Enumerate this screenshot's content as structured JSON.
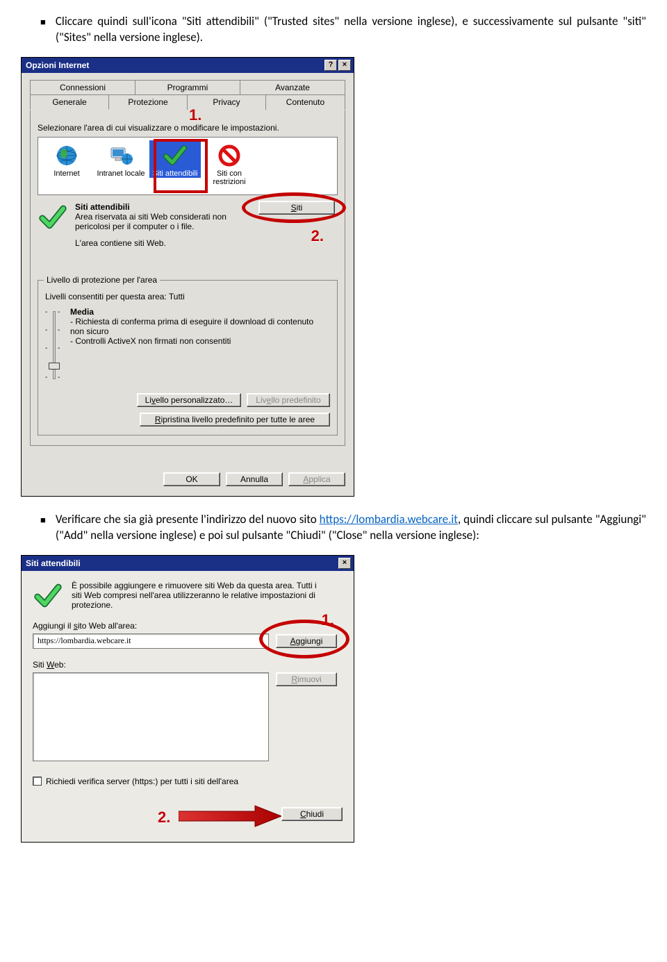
{
  "para1": "Cliccare quindi sull'icona \"Siti attendibili\" (\"Trusted sites\" nella versione inglese), e successivamente sul pulsante \"siti\" (\"Sites\" nella versione inglese).",
  "para2_a": "Verificare che sia già presente l'indirizzo del nuovo sito ",
  "para2_link": "https://lombardia.webcare.it",
  "para2_b": ", quindi cliccare sul pulsante \"Aggiungi\" (\"Add\" nella versione inglese) e poi sul pulsante \"Chiudi\" (\"Close\" nella versione inglese):",
  "dlg1": {
    "title": "Opzioni Internet",
    "help_btn": "?",
    "close_btn": "×",
    "tabs_row2": [
      "Connessioni",
      "Programmi",
      "Avanzate"
    ],
    "tabs_row1": [
      "Generale",
      "Protezione",
      "Privacy",
      "Contenuto"
    ],
    "hint": "Selezionare l'area di cui visualizzare o modificare le impostazioni.",
    "zones": [
      "Internet",
      "Intranet locale",
      "Siti attendibili",
      "Siti con restrizioni"
    ],
    "marker1": "1.",
    "marker2": "2.",
    "zone_desc_title": "Siti attendibili",
    "zone_desc_body": "Area riservata ai siti Web considerati non pericolosi per il computer o i file.",
    "zone_desc_extra": "L'area contiene siti Web.",
    "siti_btn": "Siti",
    "group_legend": "Livello di protezione per l'area",
    "allowed": "Livelli consentiti per questa area: Tutti",
    "level_name": "Media",
    "level_l1": "- Richiesta di conferma prima di eseguire il download di contenuto non sicuro",
    "level_l2": "- Controlli ActiveX non firmati non consentiti",
    "btn_custom": "Livello personalizzato…",
    "btn_default": "Livello predefinito",
    "btn_reset": "Ripristina livello predefinito per tutte le aree",
    "ok": "OK",
    "cancel": "Annulla",
    "apply": "Applica"
  },
  "dlg2": {
    "title": "Siti attendibili",
    "close_btn": "×",
    "intro": "È possibile aggiungere e rimuovere siti Web da questa area. Tutti i siti Web compresi nell'area utilizzeranno le relative impostazioni di protezione.",
    "marker1": "1.",
    "marker2": "2.",
    "field_add": "Aggiungi il sito Web all'area:",
    "input_value": "https://lombardia.webcare.it",
    "btn_add": "Aggiungi",
    "field_list": "Siti Web:",
    "btn_remove": "Rimuovi",
    "chk_label": "Richiedi verifica server (https:) per tutti i siti dell'area",
    "btn_close": "Chiudi"
  }
}
